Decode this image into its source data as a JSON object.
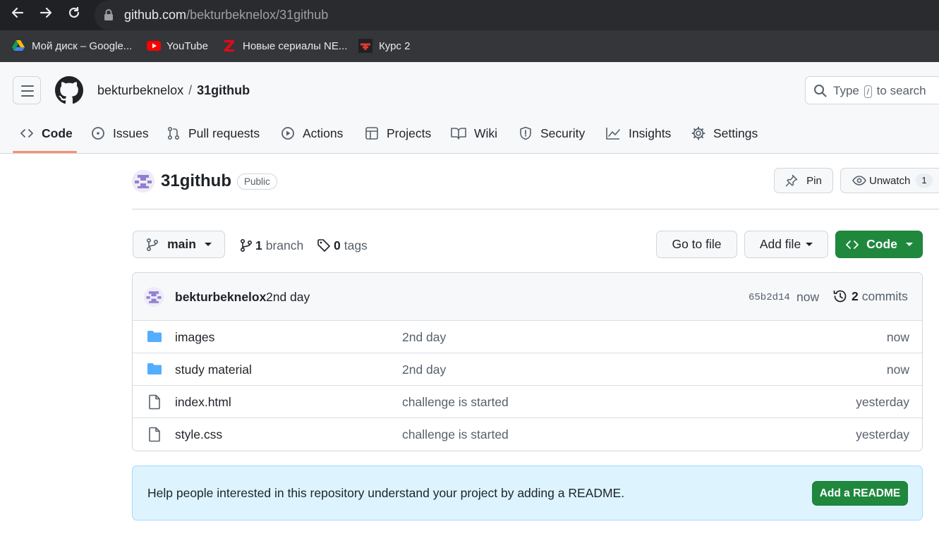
{
  "browser": {
    "url_host": "github.com",
    "url_path": "/bekturbeknelox/31github",
    "bookmarks": [
      {
        "label": "Мой диск – Google...",
        "icon": "google-drive-icon"
      },
      {
        "label": "YouTube",
        "icon": "youtube-icon"
      },
      {
        "label": "Новые сериалы NE...",
        "icon": "zetflix-icon"
      },
      {
        "label": "Курс 2",
        "icon": "course-icon"
      }
    ]
  },
  "header": {
    "owner": "bekturbeknelox",
    "separator": "/",
    "repo": "31github",
    "search_pre": "Type",
    "search_key": "/",
    "search_post": "to search"
  },
  "tabs": [
    {
      "label": "Code",
      "icon": "code-icon",
      "active": true
    },
    {
      "label": "Issues",
      "icon": "issue-icon"
    },
    {
      "label": "Pull requests",
      "icon": "pull-request-icon"
    },
    {
      "label": "Actions",
      "icon": "play-icon"
    },
    {
      "label": "Projects",
      "icon": "table-icon"
    },
    {
      "label": "Wiki",
      "icon": "book-icon"
    },
    {
      "label": "Security",
      "icon": "shield-icon"
    },
    {
      "label": "Insights",
      "icon": "graph-icon"
    },
    {
      "label": "Settings",
      "icon": "gear-icon"
    }
  ],
  "repo": {
    "name": "31github",
    "visibility": "Public",
    "pin_label": "Pin",
    "unwatch_label": "Unwatch",
    "watch_count": "1"
  },
  "toolbar": {
    "branch": "main",
    "branch_count": "1",
    "branch_word": "branch",
    "tag_count": "0",
    "tag_word": "tags",
    "go_to_file": "Go to file",
    "add_file": "Add file",
    "code": "Code"
  },
  "commit": {
    "author": "bekturbeknelox",
    "message": "2nd day",
    "sha": "65b2d14",
    "time": "now",
    "count": "2",
    "count_word": "commits"
  },
  "files": [
    {
      "type": "folder",
      "name": "images",
      "message": "2nd day",
      "age": "now"
    },
    {
      "type": "folder",
      "name": "study material",
      "message": "2nd day",
      "age": "now"
    },
    {
      "type": "file",
      "name": "index.html",
      "message": "challenge is started",
      "age": "yesterday"
    },
    {
      "type": "file",
      "name": "style.css",
      "message": "challenge is started",
      "age": "yesterday"
    }
  ],
  "readme": {
    "text": "Help people interested in this repository understand your project by adding a README.",
    "button": "Add a README"
  },
  "colors": {
    "primary_green": "#1f883d",
    "tab_underline": "#fd8c73",
    "folder_blue": "#54aeff",
    "readme_bg": "#ddf4ff"
  }
}
